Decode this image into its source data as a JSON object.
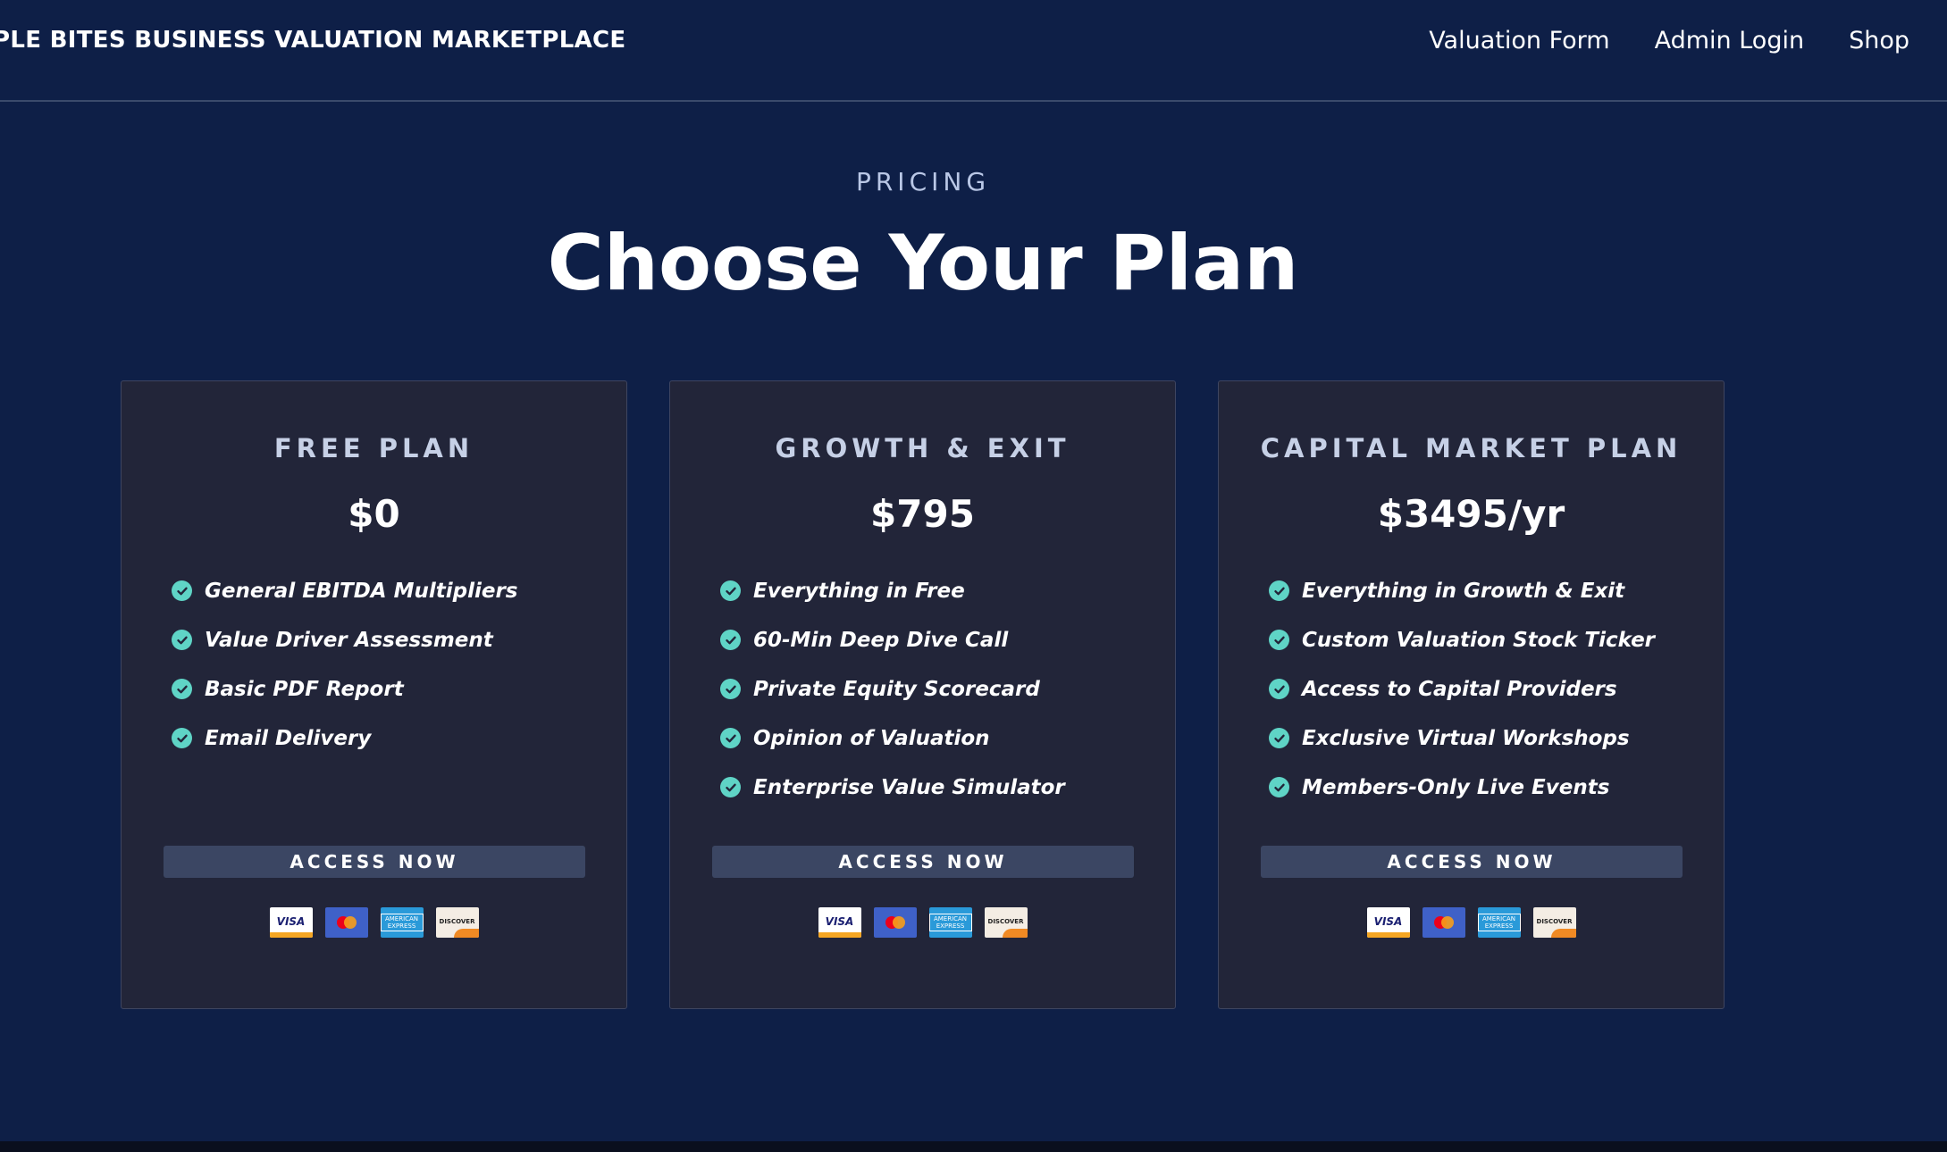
{
  "header": {
    "brand": "PLE BITES BUSINESS VALUATION MARKETPLACE",
    "nav": [
      {
        "label": "Valuation Form"
      },
      {
        "label": "Admin Login"
      },
      {
        "label": "Shop"
      }
    ]
  },
  "hero": {
    "eyebrow": "PRICING",
    "title": "Choose Your Plan"
  },
  "plans": [
    {
      "name": "FREE PLAN",
      "price": "$0",
      "features": [
        "General EBITDA Multipliers",
        "Value Driver Assessment",
        "Basic PDF Report",
        "Email Delivery"
      ],
      "button_label": "ACCESS NOW"
    },
    {
      "name": "GROWTH & EXIT",
      "price": "$795",
      "features": [
        "Everything in Free",
        "60-Min Deep Dive Call",
        "Private Equity Scorecard",
        "Opinion of Valuation",
        "Enterprise Value Simulator"
      ],
      "button_label": "ACCESS NOW"
    },
    {
      "name": "CAPITAL MARKET PLAN",
      "price": "$3495/yr",
      "features": [
        "Everything in Growth & Exit",
        "Custom Valuation Stock Ticker",
        "Access to Capital Providers",
        "Exclusive Virtual Workshops",
        "Members-Only Live Events"
      ],
      "button_label": "ACCESS NOW"
    }
  ],
  "payment_logos": {
    "visa": "VISA",
    "amex": "AMERICAN EXPRESS",
    "discover": "DISCOVER"
  },
  "colors": {
    "background": "#0e1f47",
    "card": "#222539",
    "button": "#3b4663",
    "check": "#5fd4c6"
  }
}
